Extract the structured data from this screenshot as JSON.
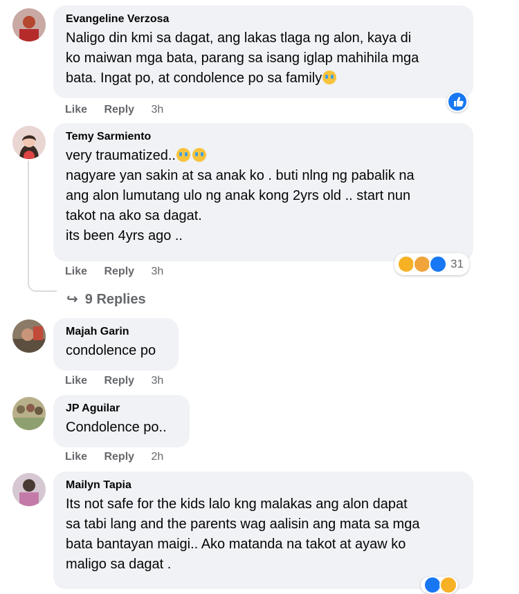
{
  "comments": [
    {
      "author": "Evangeline Verzosa",
      "lines": [
        "Naligo din kmi sa dagat, ang lakas tlaga ng alon, kaya di",
        "ko maiwan mga bata, parang sa isang iglap mahihila mga",
        "bata. Ingat po, at condolence po sa family"
      ],
      "like": "Like",
      "reply": "Reply",
      "time": "3h"
    },
    {
      "author": "Temy Sarmiento",
      "lines": [
        "very traumatized..",
        "nagyare yan sakin at sa anak ko . buti nlng ng pabalik na",
        "ang alon lumutang ulo ng anak kong 2yrs old .. start nun",
        "takot na ako sa dagat.",
        "its been 4yrs ago .."
      ],
      "like": "Like",
      "reply": "Reply",
      "time": "3h",
      "reaction_count": "31",
      "replies_label": "9 Replies"
    },
    {
      "author": "Majah Garin",
      "lines": [
        "condolence po"
      ],
      "like": "Like",
      "reply": "Reply",
      "time": "3h"
    },
    {
      "author": "JP Aguilar",
      "lines": [
        "Condolence po.."
      ],
      "like": "Like",
      "reply": "Reply",
      "time": "2h"
    },
    {
      "author": "Mailyn Tapia",
      "lines": [
        "Its not safe for the kids lalo kng malakas ang alon dapat",
        "sa tabi lang and the parents wag aalisin ang mata sa mga",
        "bata bantayan maigi.. Ako matanda na takot at ayaw ko",
        "maligo sa dagat ."
      ]
    }
  ],
  "colors": {
    "bubble": "#f0f2f5",
    "meta": "#65676b",
    "like_blue": "#1877f2"
  }
}
